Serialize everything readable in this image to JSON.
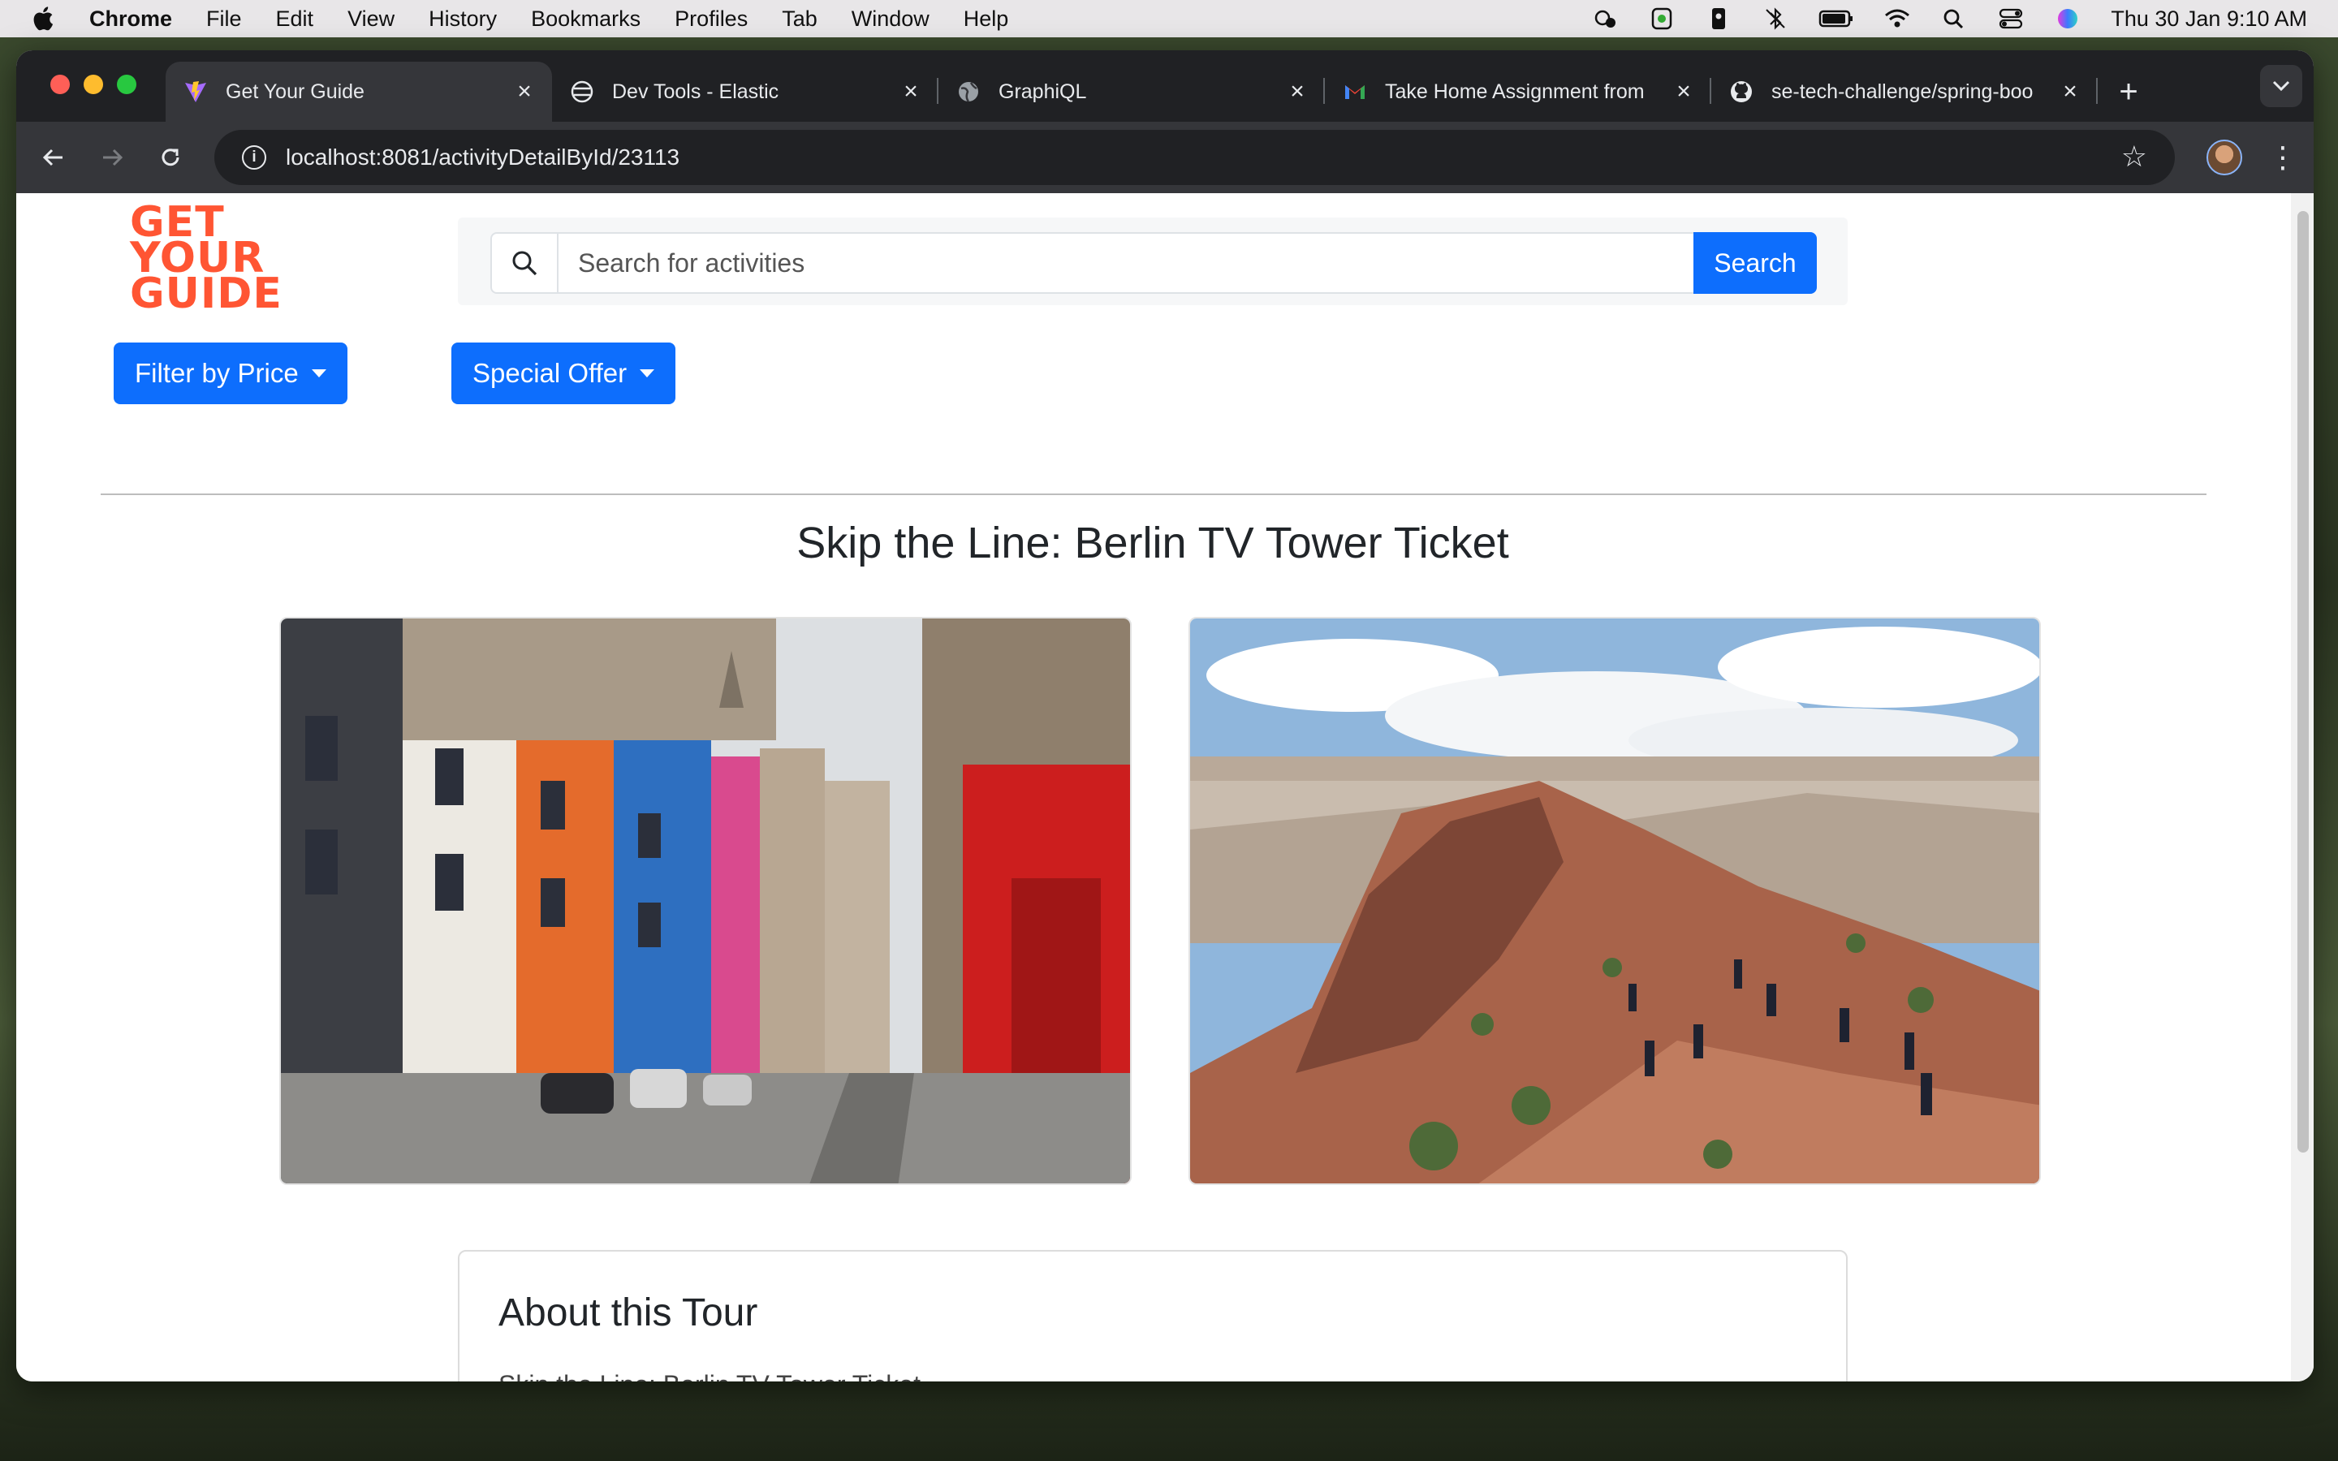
{
  "menubar": {
    "app": "Chrome",
    "items": [
      "File",
      "Edit",
      "View",
      "History",
      "Bookmarks",
      "Profiles",
      "Tab",
      "Window",
      "Help"
    ],
    "clock": "Thu 30 Jan  9:10 AM"
  },
  "browser": {
    "tabs": [
      {
        "title": "Get Your Guide",
        "icon": "vite-icon",
        "active": true
      },
      {
        "title": "Dev Tools - Elastic",
        "icon": "elastic-icon",
        "active": false
      },
      {
        "title": "GraphiQL",
        "icon": "globe-icon",
        "active": false
      },
      {
        "title": "Take Home Assignment from",
        "icon": "gmail-icon",
        "active": false
      },
      {
        "title": "se-tech-challenge/spring-boo",
        "icon": "github-icon",
        "active": false
      }
    ],
    "url": "localhost:8081/activityDetailById/23113"
  },
  "page": {
    "logo_lines": [
      "GET",
      "YOUR",
      "GUIDE"
    ],
    "search": {
      "placeholder": "Search for activities",
      "button_label": "Search"
    },
    "filters": {
      "price_label": "Filter by Price",
      "offer_label": "Special Offer"
    },
    "title": "Skip the Line: Berlin TV Tower Ticket",
    "about": {
      "heading": "About this Tour",
      "text": "Skip the Line: Berlin TV Tower Ticket"
    }
  },
  "colors": {
    "brand": "#ff5533",
    "primary": "#0d6efd"
  }
}
